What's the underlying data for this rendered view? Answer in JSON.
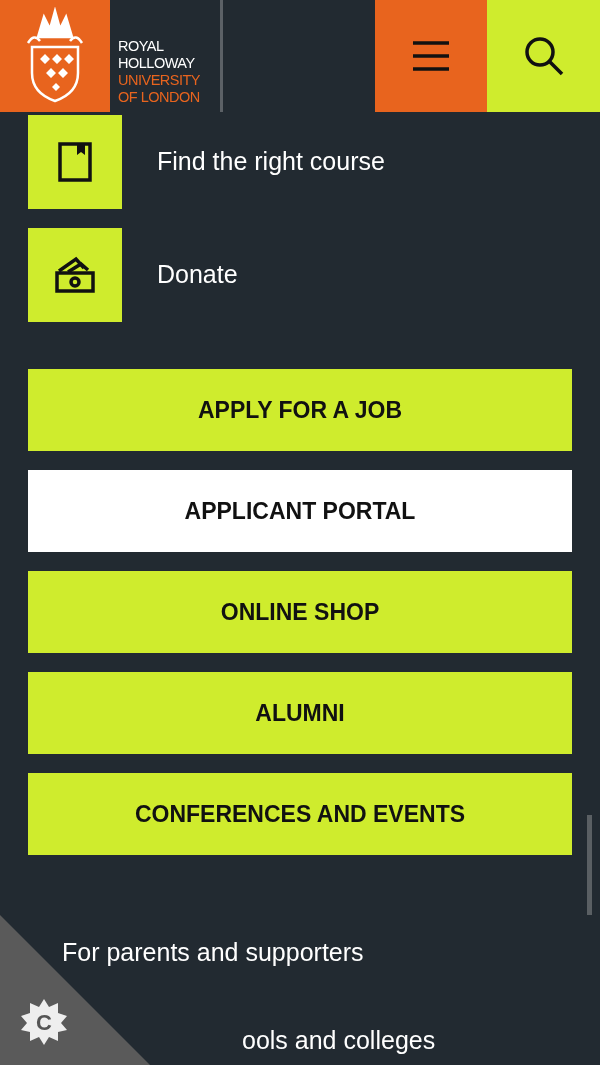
{
  "header": {
    "logo_lines": [
      {
        "text": "ROYAL",
        "kind": "light"
      },
      {
        "text": "HOLLOWAY",
        "kind": "light"
      },
      {
        "text": "UNIVERSITY",
        "kind": "accent"
      },
      {
        "text": "OF LONDON",
        "kind": "accent"
      }
    ]
  },
  "quick_links": [
    {
      "label": "Find the right course",
      "kind": "book"
    },
    {
      "label": "Donate",
      "kind": "money"
    }
  ],
  "buttons": [
    {
      "label": "APPLY FOR A JOB",
      "kind": "lime"
    },
    {
      "label": "APPLICANT PORTAL",
      "kind": "white"
    },
    {
      "label": "ONLINE SHOP",
      "kind": "lime"
    },
    {
      "label": "ALUMNI",
      "kind": "lime"
    },
    {
      "label": "CONFERENCES AND EVENTS",
      "kind": "lime"
    }
  ],
  "links": [
    {
      "label": "For parents and supporters",
      "kind": "full"
    },
    {
      "label": "ools and colleges",
      "kind": "covered"
    }
  ],
  "cookie_badge": {
    "label": "C"
  }
}
